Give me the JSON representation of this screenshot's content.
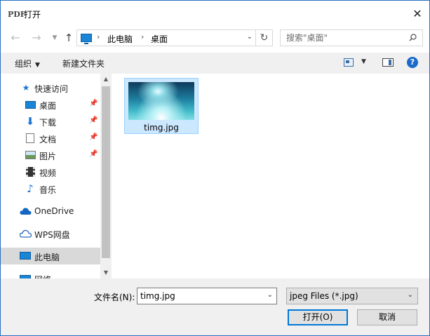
{
  "window": {
    "title": "打开",
    "app_icon": "PDF"
  },
  "nav": {
    "breadcrumb": [
      "此电脑",
      "桌面"
    ],
    "search_placeholder": "搜索\"桌面\""
  },
  "toolbar": {
    "organize_label": "组织",
    "new_folder_label": "新建文件夹"
  },
  "sidebar": {
    "items": [
      {
        "label": "快速访问",
        "icon": "star-icon",
        "pinned": false
      },
      {
        "label": "桌面",
        "icon": "desktop-icon",
        "pinned": true
      },
      {
        "label": "下载",
        "icon": "download-icon",
        "pinned": true
      },
      {
        "label": "文档",
        "icon": "document-icon",
        "pinned": true
      },
      {
        "label": "图片",
        "icon": "picture-icon",
        "pinned": true
      },
      {
        "label": "视频",
        "icon": "video-icon",
        "pinned": false
      },
      {
        "label": "音乐",
        "icon": "music-icon",
        "pinned": false
      },
      {
        "label": "OneDrive",
        "icon": "cloud-icon",
        "pinned": false
      },
      {
        "label": "WPS网盘",
        "icon": "wps-cloud-icon",
        "pinned": false
      },
      {
        "label": "此电脑",
        "icon": "computer-icon",
        "pinned": false
      },
      {
        "label": "网络",
        "icon": "network-icon",
        "pinned": false
      }
    ],
    "selected": "此电脑"
  },
  "files": [
    {
      "name": "timg.jpg",
      "selected": true
    }
  ],
  "bottom": {
    "filename_label": "文件名(N):",
    "filename_value": "timg.jpg",
    "file_type": "jpeg Files (*.jpg)",
    "open_label": "打开(O)",
    "cancel_label": "取消"
  },
  "colors": {
    "accent": "#0078d7",
    "selection_bg": "#cce8ff",
    "toolbar_bg": "#f0f0f0"
  }
}
